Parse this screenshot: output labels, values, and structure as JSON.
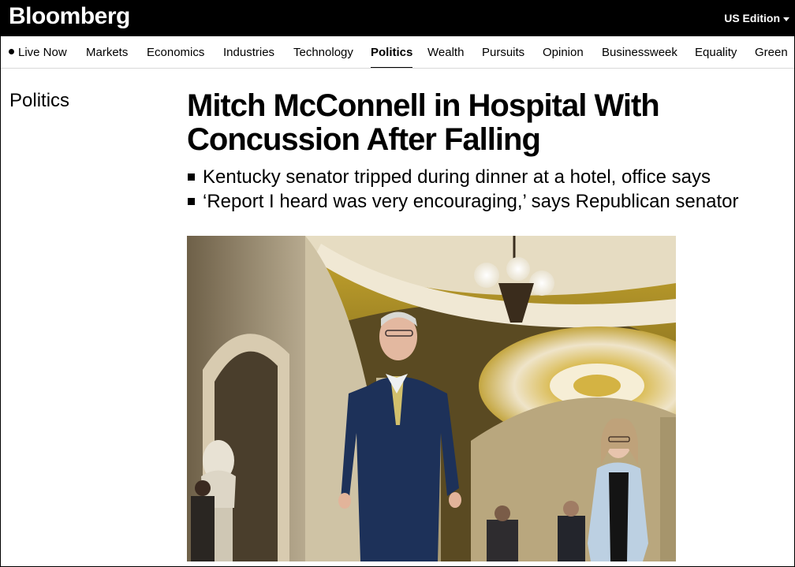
{
  "header": {
    "logo": "Bloomberg",
    "edition": "US Edition"
  },
  "nav": {
    "items": [
      {
        "label": "Live Now"
      },
      {
        "label": "Markets"
      },
      {
        "label": "Economics"
      },
      {
        "label": "Industries"
      },
      {
        "label": "Technology"
      },
      {
        "label": "Politics",
        "active": true
      },
      {
        "label": "Wealth"
      },
      {
        "label": "Pursuits"
      },
      {
        "label": "Opinion"
      },
      {
        "label": "Businessweek"
      },
      {
        "label": "Equality"
      },
      {
        "label": "Green"
      }
    ]
  },
  "article": {
    "section": "Politics",
    "headline": "Mitch McConnell in Hospital With Concussion After Falling",
    "bullets": [
      "Kentucky senator tripped during dinner at a hotel, office says",
      "‘Report I heard was very encouraging,’ says Republican senator"
    ]
  }
}
